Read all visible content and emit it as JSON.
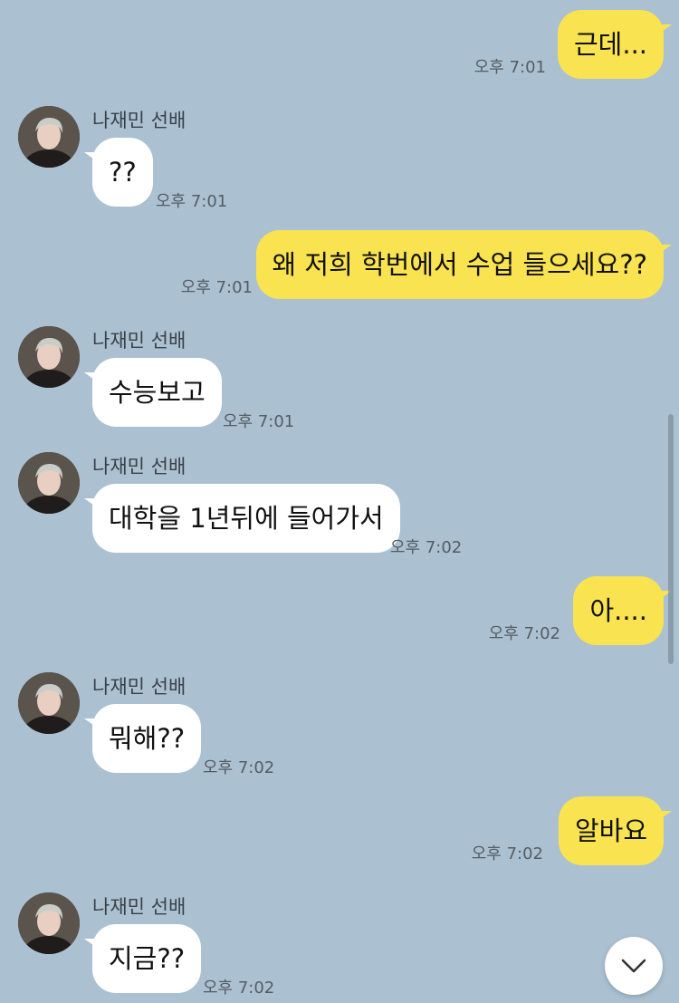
{
  "contact": {
    "name": "나재민 선배"
  },
  "colors": {
    "background": "#abc1d1",
    "outgoing_bubble": "#fae350",
    "incoming_bubble": "#ffffff"
  },
  "messages": [
    {
      "side": "out",
      "text": "근데...",
      "time": "오후 7:01"
    },
    {
      "side": "in",
      "sender": "나재민 선배",
      "text": "??",
      "time": "오후 7:01"
    },
    {
      "side": "out",
      "text": "왜 저희 학번에서 수업 들으세요??",
      "time": "오후 7:01"
    },
    {
      "side": "in",
      "sender": "나재민 선배",
      "text": "수능보고",
      "time": "오후 7:01"
    },
    {
      "side": "in",
      "sender": "나재민 선배",
      "text": "대학을 1년뒤에 들어가서",
      "time": "오후 7:02"
    },
    {
      "side": "out",
      "text": "아....",
      "time": "오후 7:02"
    },
    {
      "side": "in",
      "sender": "나재민 선배",
      "text": "뭐해??",
      "time": "오후 7:02"
    },
    {
      "side": "out",
      "text": "알바요",
      "time": "오후 7:02"
    },
    {
      "side": "in",
      "sender": "나재민 선배",
      "text": "지금??",
      "time": "오후 7:02"
    }
  ],
  "scroll_down_icon": "chevron-down-icon",
  "avatar_icon": "profile-photo"
}
